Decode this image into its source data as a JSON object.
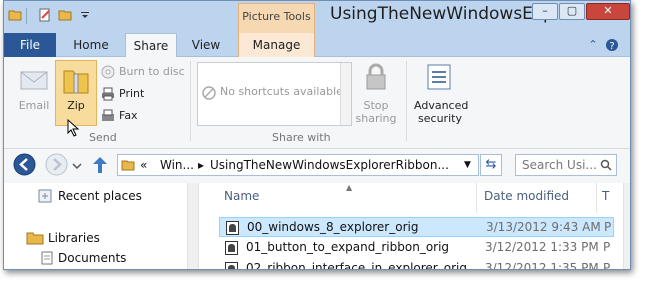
{
  "window": {
    "title": "UsingTheNewWindowsExplor",
    "context_tab_group": "Picture Tools",
    "caption_minimize": "–",
    "caption_maximize": "▢",
    "caption_close": "✕"
  },
  "tabs": [
    {
      "label": "File"
    },
    {
      "label": "Home"
    },
    {
      "label": "Share"
    },
    {
      "label": "View"
    },
    {
      "label": "Manage"
    }
  ],
  "ribbon": {
    "email_label": "Email",
    "zip_label": "Zip",
    "burn_label": "Burn to disc",
    "print_label": "Print",
    "fax_label": "Fax",
    "send_group": "Send",
    "shortcuts_placeholder": "No shortcuts available",
    "stop_sharing_line1": "Stop",
    "stop_sharing_line2": "sharing",
    "share_with_group": "Share with",
    "advanced_line1": "Advanced",
    "advanced_line2": "security"
  },
  "address": {
    "chevrons": "«",
    "crumb1": "Win...",
    "crumb2": "UsingTheNewWindowsExplorerRibbon...",
    "search_placeholder": "Search Usi..."
  },
  "nav_pane": {
    "items": [
      {
        "label": "Recent places"
      },
      {
        "label": "Libraries"
      },
      {
        "label": "Documents"
      }
    ]
  },
  "file_list": {
    "columns": [
      "Name",
      "Date modified",
      "T"
    ],
    "rows": [
      {
        "name": "00_windows_8_explorer_orig",
        "date": "3/13/2012 9:43 AM",
        "type": "P",
        "selected": true
      },
      {
        "name": "01_button_to_expand_ribbon_orig",
        "date": "3/12/2012 1:33 PM",
        "type": "P",
        "selected": false
      },
      {
        "name": "02_ribbon_interface_in_explorer_orig",
        "date": "3/12/2012 1:35 PM",
        "type": "P",
        "selected": false
      }
    ]
  },
  "colors": {
    "file_tab": "#2b5797",
    "title_bar": "#bcd4ee",
    "context_tab": "#f6d8b2",
    "selection": "#cce8ff"
  }
}
